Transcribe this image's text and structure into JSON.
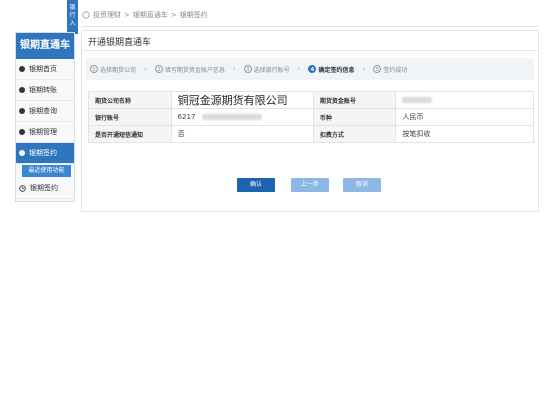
{
  "side_badge": "银行入",
  "breadcrumb": {
    "items": [
      "投资理财",
      "银期直通车",
      "银期签约"
    ],
    "sep": ">"
  },
  "sidebar": {
    "title": "银期直通车",
    "items": [
      {
        "label": "银期首页",
        "active": false
      },
      {
        "label": "银期转账",
        "active": false
      },
      {
        "label": "银期查询",
        "active": false
      },
      {
        "label": "银期管理",
        "active": false
      },
      {
        "label": "银期签约",
        "active": true
      }
    ],
    "sub_item": "最近使用功能",
    "extra_item": "银期签约"
  },
  "main": {
    "title": "开通银期直通车",
    "steps": [
      {
        "num": "1",
        "label": "选择期货公司"
      },
      {
        "num": "2",
        "label": "填写期货资金账户信息"
      },
      {
        "num": "3",
        "label": "选择银行账号"
      },
      {
        "num": "4",
        "label": "确定签约信息",
        "active": true
      },
      {
        "num": "5",
        "label": "签约成功"
      }
    ],
    "table": {
      "rows": [
        {
          "l1": "期货公司名称",
          "v1": "铜冠金源期货有限公司",
          "l2": "期货资金账号",
          "v2": ""
        },
        {
          "l1": "银行账号",
          "v1": "6217",
          "l2": "币种",
          "v2": "人民币"
        },
        {
          "l1": "是否开通短信通知",
          "v1": "否",
          "l2": "扣费方式",
          "v2": "按笔扣收"
        }
      ]
    },
    "buttons": {
      "confirm": "确认",
      "prev": "上一步",
      "cancel": "取消"
    }
  }
}
